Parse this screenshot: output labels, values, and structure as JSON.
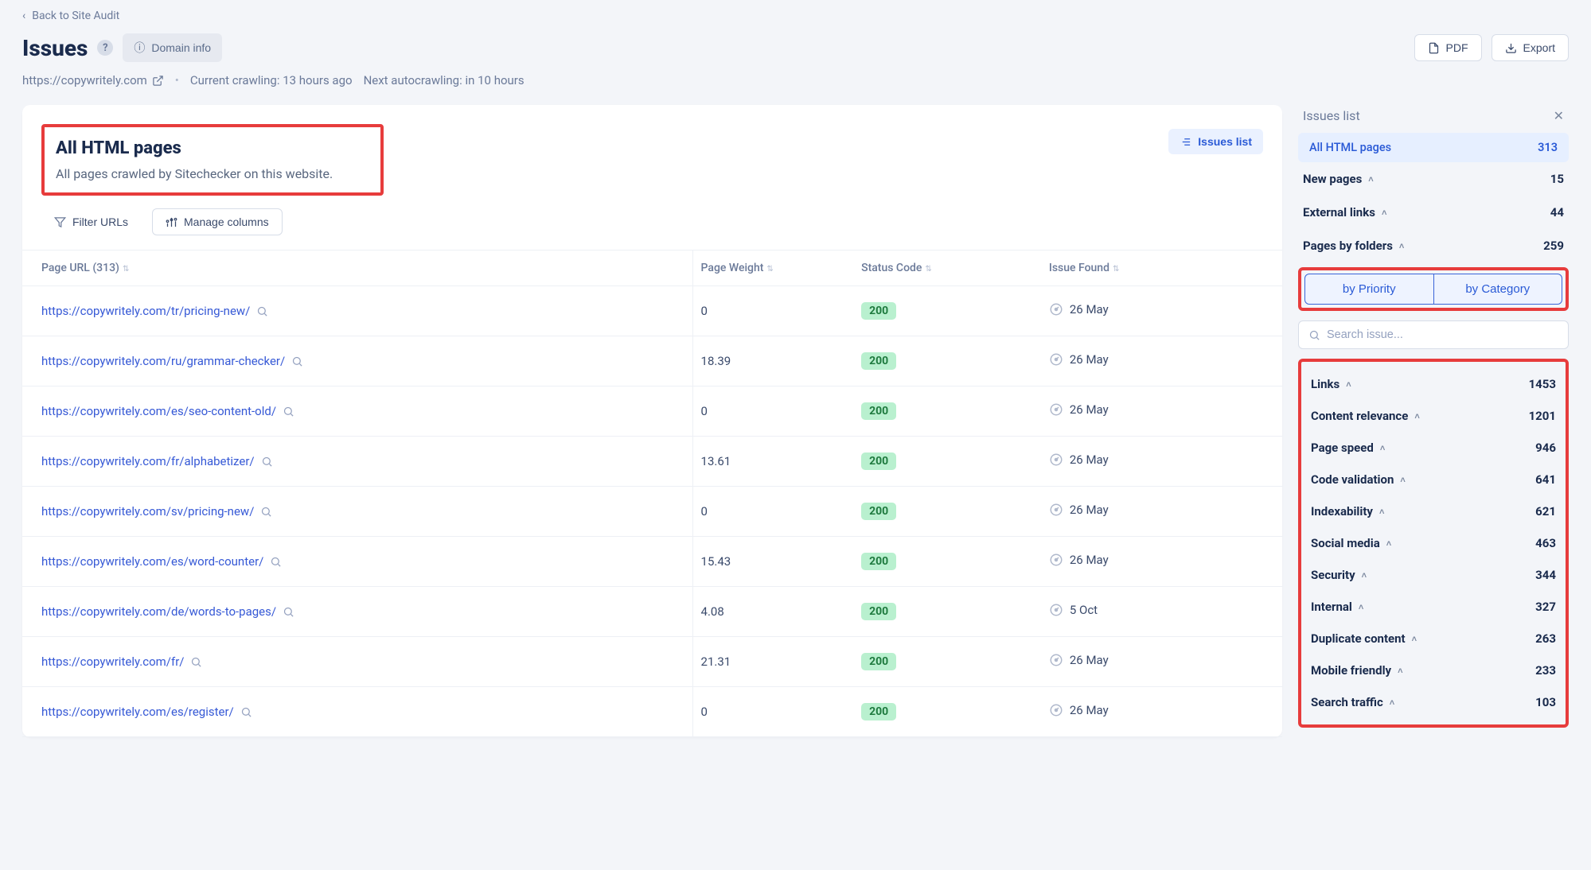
{
  "back_link": "Back to Site Audit",
  "title": "Issues",
  "domain_info_btn": "Domain info",
  "pdf_btn": "PDF",
  "export_btn": "Export",
  "site_url": "https://copywritely.com",
  "crawling_text": "Current crawling: 13 hours ago",
  "autocrawl_text": "Next autocrawling: in 10 hours",
  "section": {
    "title": "All HTML pages",
    "desc": "All pages crawled by Sitechecker on this website.",
    "issues_list_btn": "Issues list"
  },
  "toolbar": {
    "filter": "Filter URLs",
    "columns": "Manage columns"
  },
  "columns": {
    "url": "Page URL (313)",
    "weight": "Page Weight",
    "status": "Status Code",
    "found": "Issue Found"
  },
  "rows": [
    {
      "url": "https://copywritely.com/tr/pricing-new/",
      "weight": "0",
      "status": "200",
      "found": "26 May"
    },
    {
      "url": "https://copywritely.com/ru/grammar-checker/",
      "weight": "18.39",
      "status": "200",
      "found": "26 May"
    },
    {
      "url": "https://copywritely.com/es/seo-content-old/",
      "weight": "0",
      "status": "200",
      "found": "26 May"
    },
    {
      "url": "https://copywritely.com/fr/alphabetizer/",
      "weight": "13.61",
      "status": "200",
      "found": "26 May"
    },
    {
      "url": "https://copywritely.com/sv/pricing-new/",
      "weight": "0",
      "status": "200",
      "found": "26 May"
    },
    {
      "url": "https://copywritely.com/es/word-counter/",
      "weight": "15.43",
      "status": "200",
      "found": "26 May"
    },
    {
      "url": "https://copywritely.com/de/words-to-pages/",
      "weight": "4.08",
      "status": "200",
      "found": "5 Oct"
    },
    {
      "url": "https://copywritely.com/fr/",
      "weight": "21.31",
      "status": "200",
      "found": "26 May"
    },
    {
      "url": "https://copywritely.com/es/register/",
      "weight": "0",
      "status": "200",
      "found": "26 May"
    }
  ],
  "sidebar": {
    "title": "Issues list",
    "active": {
      "label": "All HTML pages",
      "count": "313"
    },
    "groups": [
      {
        "label": "New pages",
        "count": "15"
      },
      {
        "label": "External links",
        "count": "44"
      },
      {
        "label": "Pages by folders",
        "count": "259"
      }
    ],
    "tabs": {
      "priority": "by Priority",
      "category": "by Category"
    },
    "search_placeholder": "Search issue...",
    "categories": [
      {
        "label": "Links",
        "count": "1453"
      },
      {
        "label": "Content relevance",
        "count": "1201"
      },
      {
        "label": "Page speed",
        "count": "946"
      },
      {
        "label": "Code validation",
        "count": "641"
      },
      {
        "label": "Indexability",
        "count": "621"
      },
      {
        "label": "Social media",
        "count": "463"
      },
      {
        "label": "Security",
        "count": "344"
      },
      {
        "label": "Internal",
        "count": "327"
      },
      {
        "label": "Duplicate content",
        "count": "263"
      },
      {
        "label": "Mobile friendly",
        "count": "233"
      },
      {
        "label": "Search traffic",
        "count": "103"
      }
    ]
  }
}
